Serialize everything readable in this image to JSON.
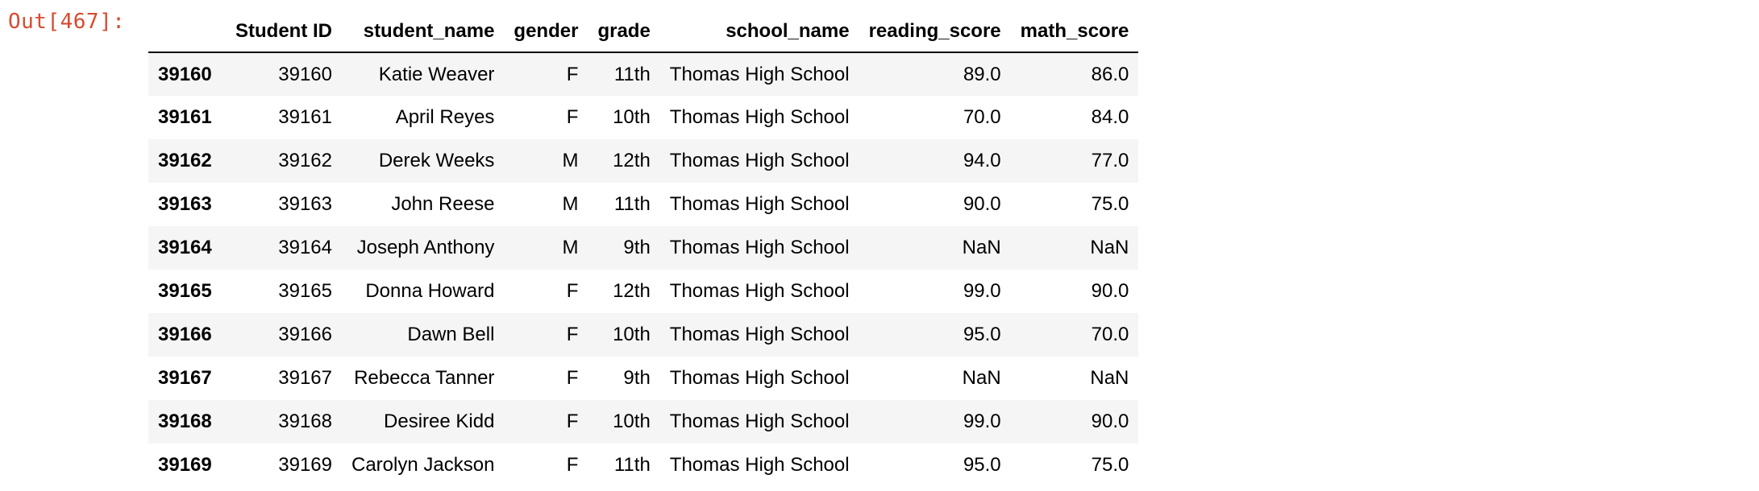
{
  "cell": {
    "prompt": "Out[467]:"
  },
  "table": {
    "columns": [
      "",
      "Student ID",
      "student_name",
      "gender",
      "grade",
      "school_name",
      "reading_score",
      "math_score"
    ],
    "rows": [
      {
        "index": "39160",
        "student_id": "39160",
        "student_name": "Katie Weaver",
        "gender": "F",
        "grade": "11th",
        "school_name": "Thomas High School",
        "reading_score": "89.0",
        "math_score": "86.0"
      },
      {
        "index": "39161",
        "student_id": "39161",
        "student_name": "April Reyes",
        "gender": "F",
        "grade": "10th",
        "school_name": "Thomas High School",
        "reading_score": "70.0",
        "math_score": "84.0"
      },
      {
        "index": "39162",
        "student_id": "39162",
        "student_name": "Derek Weeks",
        "gender": "M",
        "grade": "12th",
        "school_name": "Thomas High School",
        "reading_score": "94.0",
        "math_score": "77.0"
      },
      {
        "index": "39163",
        "student_id": "39163",
        "student_name": "John Reese",
        "gender": "M",
        "grade": "11th",
        "school_name": "Thomas High School",
        "reading_score": "90.0",
        "math_score": "75.0"
      },
      {
        "index": "39164",
        "student_id": "39164",
        "student_name": "Joseph Anthony",
        "gender": "M",
        "grade": "9th",
        "school_name": "Thomas High School",
        "reading_score": "NaN",
        "math_score": "NaN"
      },
      {
        "index": "39165",
        "student_id": "39165",
        "student_name": "Donna Howard",
        "gender": "F",
        "grade": "12th",
        "school_name": "Thomas High School",
        "reading_score": "99.0",
        "math_score": "90.0"
      },
      {
        "index": "39166",
        "student_id": "39166",
        "student_name": "Dawn Bell",
        "gender": "F",
        "grade": "10th",
        "school_name": "Thomas High School",
        "reading_score": "95.0",
        "math_score": "70.0"
      },
      {
        "index": "39167",
        "student_id": "39167",
        "student_name": "Rebecca Tanner",
        "gender": "F",
        "grade": "9th",
        "school_name": "Thomas High School",
        "reading_score": "NaN",
        "math_score": "NaN"
      },
      {
        "index": "39168",
        "student_id": "39168",
        "student_name": "Desiree Kidd",
        "gender": "F",
        "grade": "10th",
        "school_name": "Thomas High School",
        "reading_score": "99.0",
        "math_score": "90.0"
      },
      {
        "index": "39169",
        "student_id": "39169",
        "student_name": "Carolyn Jackson",
        "gender": "F",
        "grade": "11th",
        "school_name": "Thomas High School",
        "reading_score": "95.0",
        "math_score": "75.0"
      }
    ]
  },
  "colors": {
    "prompt": "#d84a30",
    "stripe": "#f5f5f5"
  }
}
